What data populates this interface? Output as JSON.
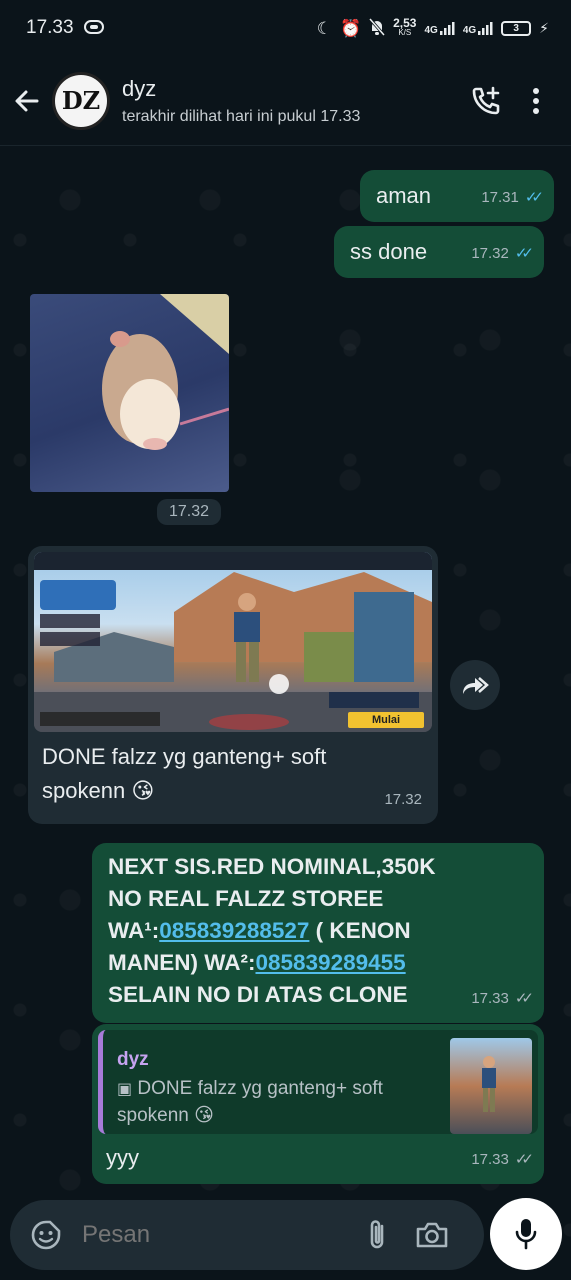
{
  "status_bar": {
    "time": "17.33",
    "net_speed_value": "2,53",
    "net_speed_unit": "K/S",
    "network_1": "4G",
    "network_2": "4G",
    "battery_level": "3"
  },
  "header": {
    "contact_name": "dyz",
    "avatar_text": "DZ",
    "last_seen": "terakhir dilihat hari ini pukul 17.33"
  },
  "messages": [
    {
      "id": "m1",
      "direction": "out",
      "text": "aman",
      "time": "17.31",
      "status": "read"
    },
    {
      "id": "m2",
      "direction": "out",
      "text": "ss done",
      "time": "17.32",
      "status": "read"
    },
    {
      "id": "m3",
      "direction": "in",
      "type": "image",
      "time": "17.32"
    },
    {
      "id": "m4",
      "direction": "in",
      "type": "image_caption",
      "caption_line1": "DONE falzz yg ganteng+ soft",
      "caption_line2": "spokenn",
      "emoji": "😘",
      "time": "17.32"
    },
    {
      "id": "m5",
      "direction": "out",
      "line1": "NEXT SIS.RED NOMINAL,350K",
      "line2": "NO REAL FALZZ STOREE",
      "line3_prefix": "WA¹:",
      "phone_1": "085839288527",
      "line3_suffix": " ( KENON",
      "line4_prefix": "MANEN) WA²:",
      "phone_2": "085839289455",
      "line5": "SELAIN NO DI ATAS CLONE",
      "time": "17.33",
      "status": "delivered"
    },
    {
      "id": "m6",
      "direction": "out",
      "reply_to_name": "dyz",
      "reply_to_text_line1": "DONE falzz yg ganteng+ soft",
      "reply_to_text_line2": "spokenn",
      "reply_emoji": "😘",
      "text": "yyy",
      "time": "17.33",
      "status": "delivered"
    }
  ],
  "game_screenshot": {
    "button_label": "Mulai"
  },
  "composer": {
    "placeholder": "Pesan"
  },
  "icons": {
    "back": "arrow-left-icon",
    "add_call": "phone-plus-icon",
    "menu": "more-vertical-icon",
    "emoji": "emoji-icon",
    "attach": "paperclip-icon",
    "camera": "camera-icon",
    "mic": "mic-icon",
    "forward": "forward-icon"
  },
  "colors": {
    "background": "#0b141a",
    "outgoing_bubble": "#144d37",
    "incoming_bubble": "#1f2c34",
    "read_ticks": "#53bdeb",
    "link": "#53bdeb",
    "reply_bar": "#a77bd8"
  }
}
